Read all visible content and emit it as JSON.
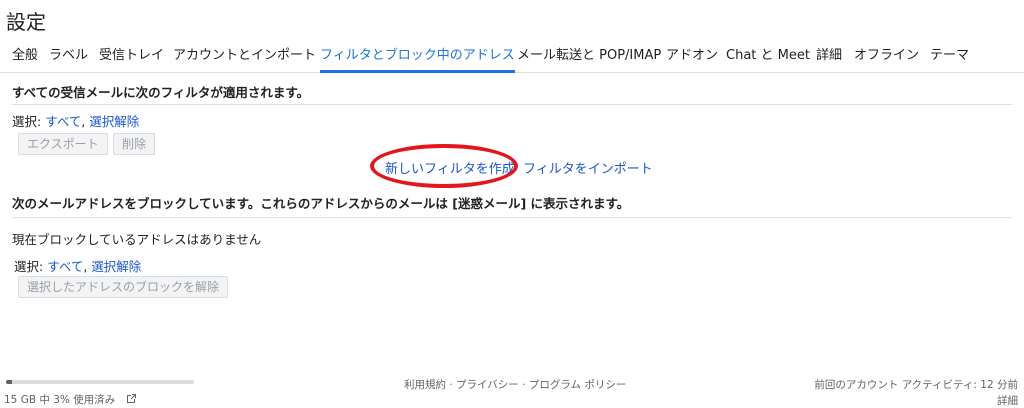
{
  "page_title": "設定",
  "tabs": [
    {
      "label": "全般"
    },
    {
      "label": "ラベル"
    },
    {
      "label": "受信トレイ"
    },
    {
      "label": "アカウントとインポート"
    },
    {
      "label": "フィルタとブロック中のアドレス",
      "active": true
    },
    {
      "label": "メール転送と POP/IMAP"
    },
    {
      "label": "アドオン"
    },
    {
      "label": "Chat と Meet"
    },
    {
      "label": "詳細"
    },
    {
      "label": "オフライン"
    },
    {
      "label": "テーマ"
    }
  ],
  "filters": {
    "heading": "すべての受信メールに次のフィルタが適用されます。",
    "select_label": "選択: ",
    "select_all": "すべて",
    "separator": ", ",
    "select_none": "選択解除",
    "export_button": "エクスポート",
    "delete_button": "削除",
    "create_filter": "新しいフィルタを作成",
    "import_filter": "フィルタをインポート"
  },
  "blocked": {
    "heading": "次のメールアドレスをブロックしています。これらのアドレスからのメールは [迷惑メール] に表示されます。",
    "empty_message": "現在ブロックしているアドレスはありません",
    "select_label": "選択: ",
    "select_all": "すべて",
    "separator": ", ",
    "select_none": "選択解除",
    "unblock_button": "選択したアドレスのブロックを解除"
  },
  "footer": {
    "storage_text": "15 GB 中 3% 使用済み",
    "storage_fraction": 0.03,
    "terms": "利用規約",
    "privacy": "プライバシー",
    "program_policy": "プログラム ポリシー",
    "dot": " · ",
    "last_activity": "前回のアカウント アクティビティ: 12 分前",
    "details": "詳細"
  },
  "colors": {
    "link": "#1a56d8",
    "active_tab": "#1a73e8",
    "highlight_ring": "#e3161b"
  }
}
